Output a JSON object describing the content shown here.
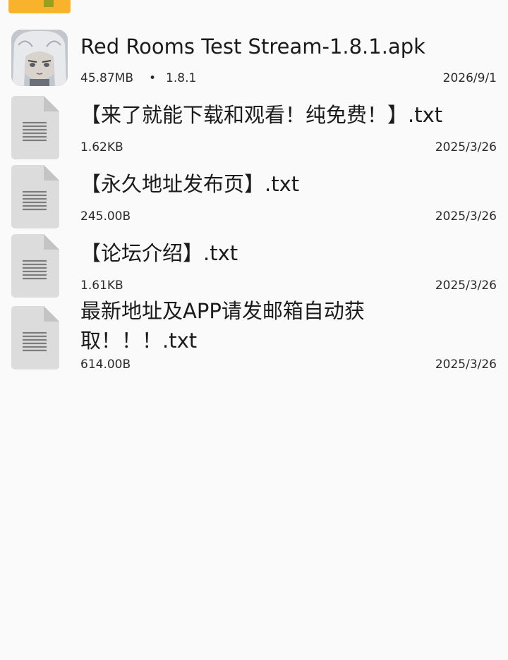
{
  "files": [
    {
      "name": "Red Rooms Test Stream-1.8.1.apk",
      "size": "45.87MB",
      "separator": "•",
      "version": "1.8.1",
      "date": "2026/9/1",
      "icon": "app-icon"
    },
    {
      "name": "【来了就能下载和观看！纯免费！】.txt",
      "size": "1.62KB",
      "date": "2025/3/26",
      "icon": "text-file-icon"
    },
    {
      "name": "【永久地址发布页】.txt",
      "size": "245.00B",
      "date": "2025/3/26",
      "icon": "text-file-icon"
    },
    {
      "name": "【论坛介绍】.txt",
      "size": "1.61KB",
      "date": "2025/3/26",
      "icon": "text-file-icon"
    },
    {
      "name": "最新地址及APP请发邮箱自动获取！！！.txt",
      "size": "614.00B",
      "date": "2025/3/26",
      "icon": "text-file-icon"
    }
  ],
  "colors": {
    "background": "#fafafa",
    "folder": "#f8b22c",
    "doc_icon": "#dcdcdc"
  }
}
